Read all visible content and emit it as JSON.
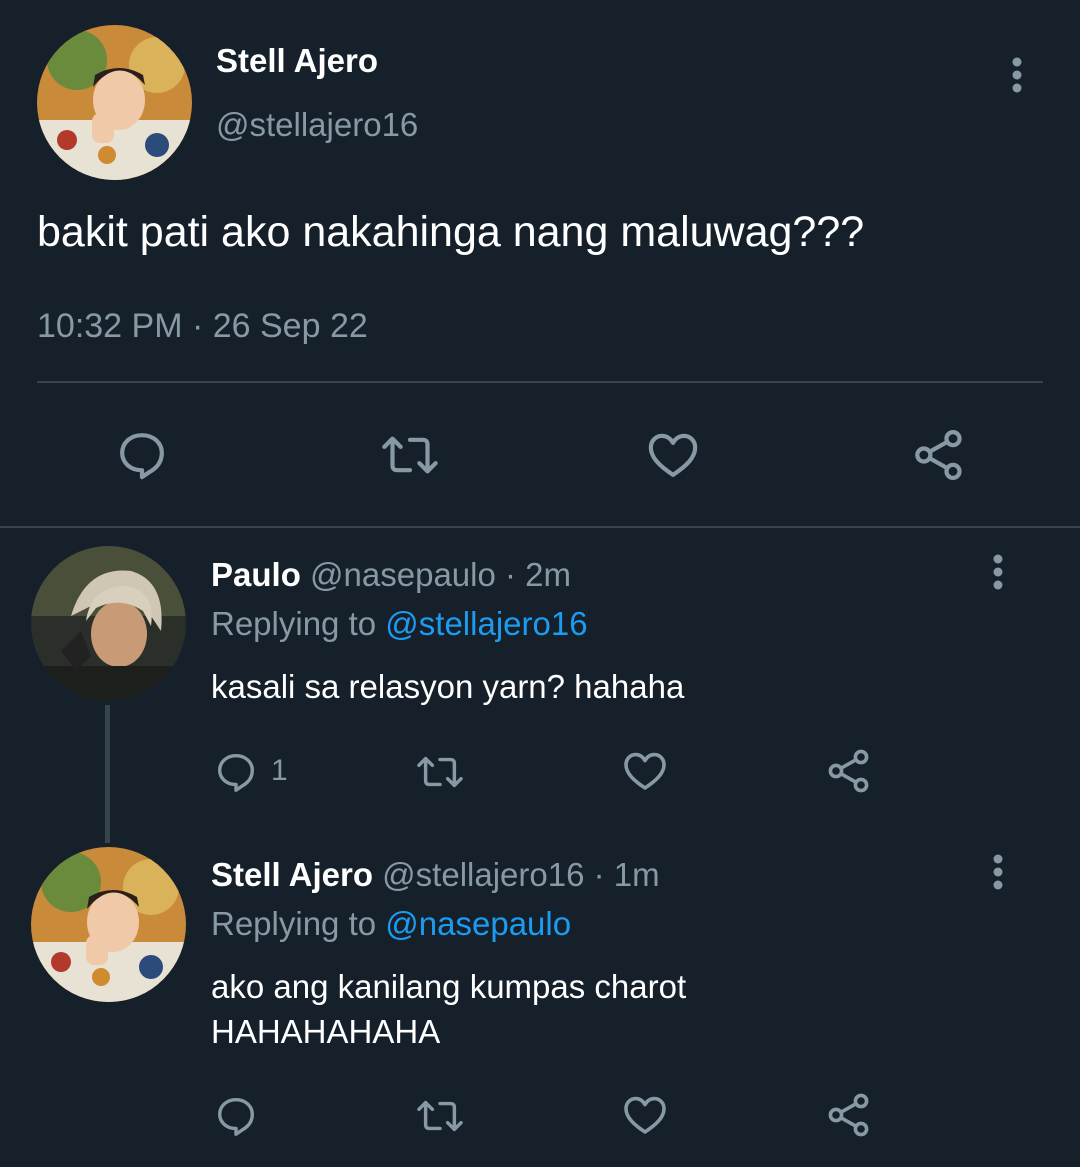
{
  "main_tweet": {
    "display_name": "Stell Ajero",
    "handle": "@stellajero16",
    "text": "bakit pati ako nakahinga nang maluwag???",
    "timestamp": "10:32 PM · 26 Sep 22",
    "actions": [
      "reply-icon",
      "retweet-icon",
      "like-icon",
      "share-icon"
    ]
  },
  "replies": [
    {
      "display_name": "Paulo",
      "handle": "@nasepaulo",
      "time": "· 2m",
      "replying_label": "Replying to",
      "replying_to": "@stellajero16",
      "text": "kasali sa relasyon yarn? hahaha",
      "reply_count": "1"
    },
    {
      "display_name": "Stell Ajero",
      "handle": "@stellajero16",
      "time": "· 1m",
      "replying_label": "Replying to",
      "replying_to": "@nasepaulo",
      "text_line1": "ako ang kanilang kumpas charot",
      "text_line2": "HAHAHAHAHA"
    }
  ],
  "colors": {
    "background": "#15202b",
    "muted": "#8899a6",
    "link": "#1d9bf0",
    "divider": "#38444d"
  }
}
